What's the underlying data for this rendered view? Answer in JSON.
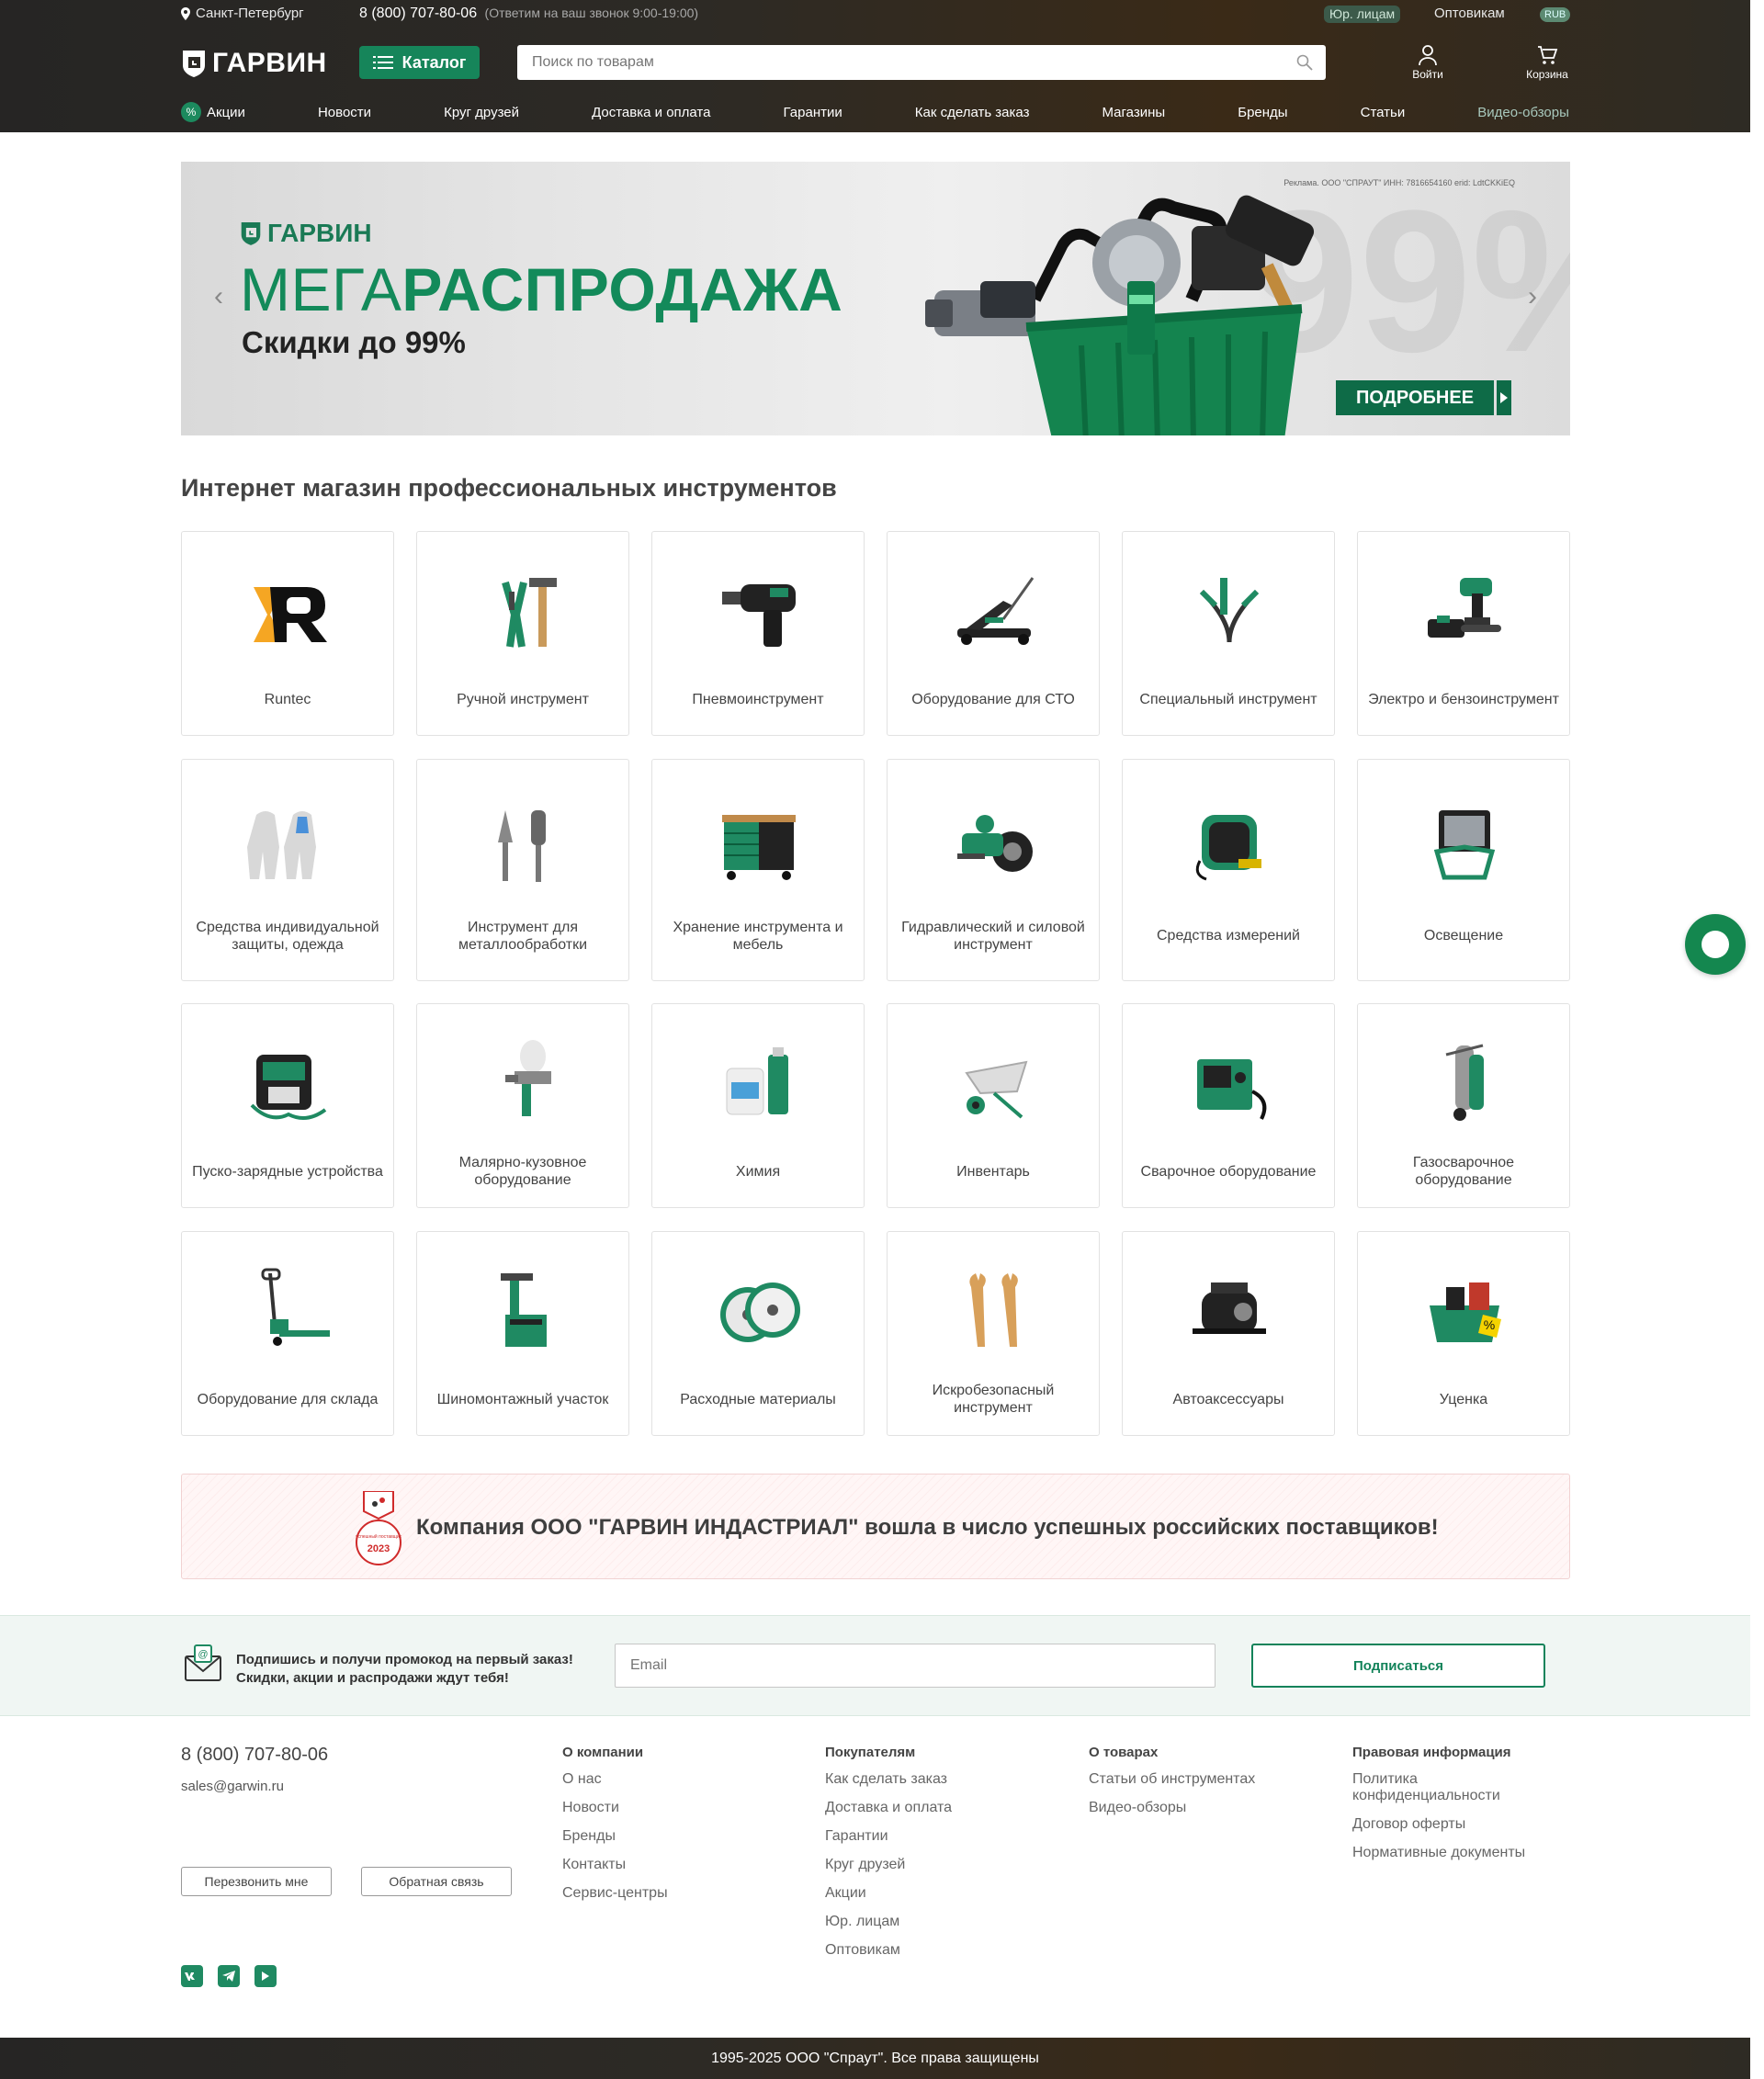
{
  "topbar": {
    "city": "Санкт-Петербург",
    "phone": "8 (800) 707-80-06",
    "phone_hint": "(Ответим на ваш звонок 9:00-19:00)",
    "legal": "Юр. лицам",
    "wholesale": "Оптовикам",
    "currency": "RUB"
  },
  "header": {
    "logo": "ГАРВИН",
    "catalog_label": "Каталог",
    "search_placeholder": "Поиск по товарам",
    "login_label": "Войти",
    "cart_label": "Корзина"
  },
  "nav": [
    "Акции",
    "Новости",
    "Круг друзей",
    "Доставка и оплата",
    "Гарантии",
    "Как сделать заказ",
    "Магазины",
    "Бренды",
    "Статьи",
    "Видео-обзоры"
  ],
  "banner": {
    "ad_text": "Реклама. ООО \"СПРАУТ\" ИНН: 7816654160 erid: LdtCKKiEQ",
    "logo": "ГАРВИН",
    "title_light": "МЕГА",
    "title_bold": "РАСПРОДАЖА",
    "subtitle": "Скидки до 99%",
    "big_number": "99%",
    "more_label": "ПОДРОБНЕЕ",
    "prev_arrow": "‹",
    "next_arrow": "›"
  },
  "section_title": "Интернет магазин профессиональных инструментов",
  "categories": [
    {
      "label": "Runtec",
      "icon": "runtec-logo"
    },
    {
      "label": "Ручной инструмент",
      "icon": "pliers-hammer"
    },
    {
      "label": "Пневмоинструмент",
      "icon": "impact-wrench"
    },
    {
      "label": "Оборудование для СТО",
      "icon": "floor-jack"
    },
    {
      "label": "Специальный инструмент",
      "icon": "puller"
    },
    {
      "label": "Электро и бензоинструмент",
      "icon": "drill-chainsaw"
    },
    {
      "label": "Средства индивидуальной защиты, одежда",
      "icon": "coveralls"
    },
    {
      "label": "Инструмент для металлообработки",
      "icon": "burrs"
    },
    {
      "label": "Хранение инструмента и мебель",
      "icon": "tool-cabinet"
    },
    {
      "label": "Гидравлический и силовой инструмент",
      "icon": "hydraulic-wrench"
    },
    {
      "label": "Средства измерений",
      "icon": "tape-measure"
    },
    {
      "label": "Освещение",
      "icon": "floodlight"
    },
    {
      "label": "Пуско-зарядные устройства",
      "icon": "jump-starter"
    },
    {
      "label": "Малярно-кузовное оборудование",
      "icon": "spray-gun"
    },
    {
      "label": "Химия",
      "icon": "chemicals"
    },
    {
      "label": "Инвентарь",
      "icon": "wheelbarrow"
    },
    {
      "label": "Сварочное оборудование",
      "icon": "welder"
    },
    {
      "label": "Газосварочное оборудование",
      "icon": "gas-welding"
    },
    {
      "label": "Оборудование для склада",
      "icon": "pallet-jack"
    },
    {
      "label": "Шиномонтажный участок",
      "icon": "tire-changer"
    },
    {
      "label": "Расходные материалы",
      "icon": "cutting-discs"
    },
    {
      "label": "Искробезопасный инструмент",
      "icon": "spark-free-wrenches"
    },
    {
      "label": "Автоаксессуары",
      "icon": "compressor"
    },
    {
      "label": "Уценка",
      "icon": "markdown-basket"
    }
  ],
  "supplier": {
    "text": "Компания ООО \"ГАРВИН ИНДАСТРИАЛ\" вошла в число успешных российских поставщиков!",
    "badge_year": "2023",
    "badge_text": "успешный поставщик"
  },
  "subscribe": {
    "line1": "Подпишись и получи промокод на первый заказ!",
    "line2": "Скидки, акции и распродажи ждут тебя!",
    "placeholder": "Email",
    "button": "Подписаться"
  },
  "footer": {
    "phone": "8 (800) 707-80-06",
    "email": "sales@garwin.ru",
    "callback": "Перезвонить мне",
    "feedback": "Обратная связь",
    "columns": [
      {
        "title": "О компании",
        "items": [
          "О нас",
          "Новости",
          "Бренды",
          "Контакты",
          "Сервис-центры"
        ]
      },
      {
        "title": "Покупателям",
        "items": [
          "Как сделать заказ",
          "Доставка и оплата",
          "Гарантии",
          "Круг друзей",
          "Акции",
          "Юр. лицам",
          "Оптовикам"
        ]
      },
      {
        "title": "О товарах",
        "items": [
          "Статьи об инструментах",
          "Видео-обзоры"
        ]
      },
      {
        "title": "Правовая информация",
        "items": [
          "Политика конфиденциальности",
          "Договор оферты",
          "Нормативные документы"
        ]
      }
    ],
    "copyright": "1995-2025 ООО \"Спраут\". Все права защищены"
  },
  "colors": {
    "brand_green": "#16855a",
    "dark_header": "#2d2a25",
    "text": "#444444"
  }
}
